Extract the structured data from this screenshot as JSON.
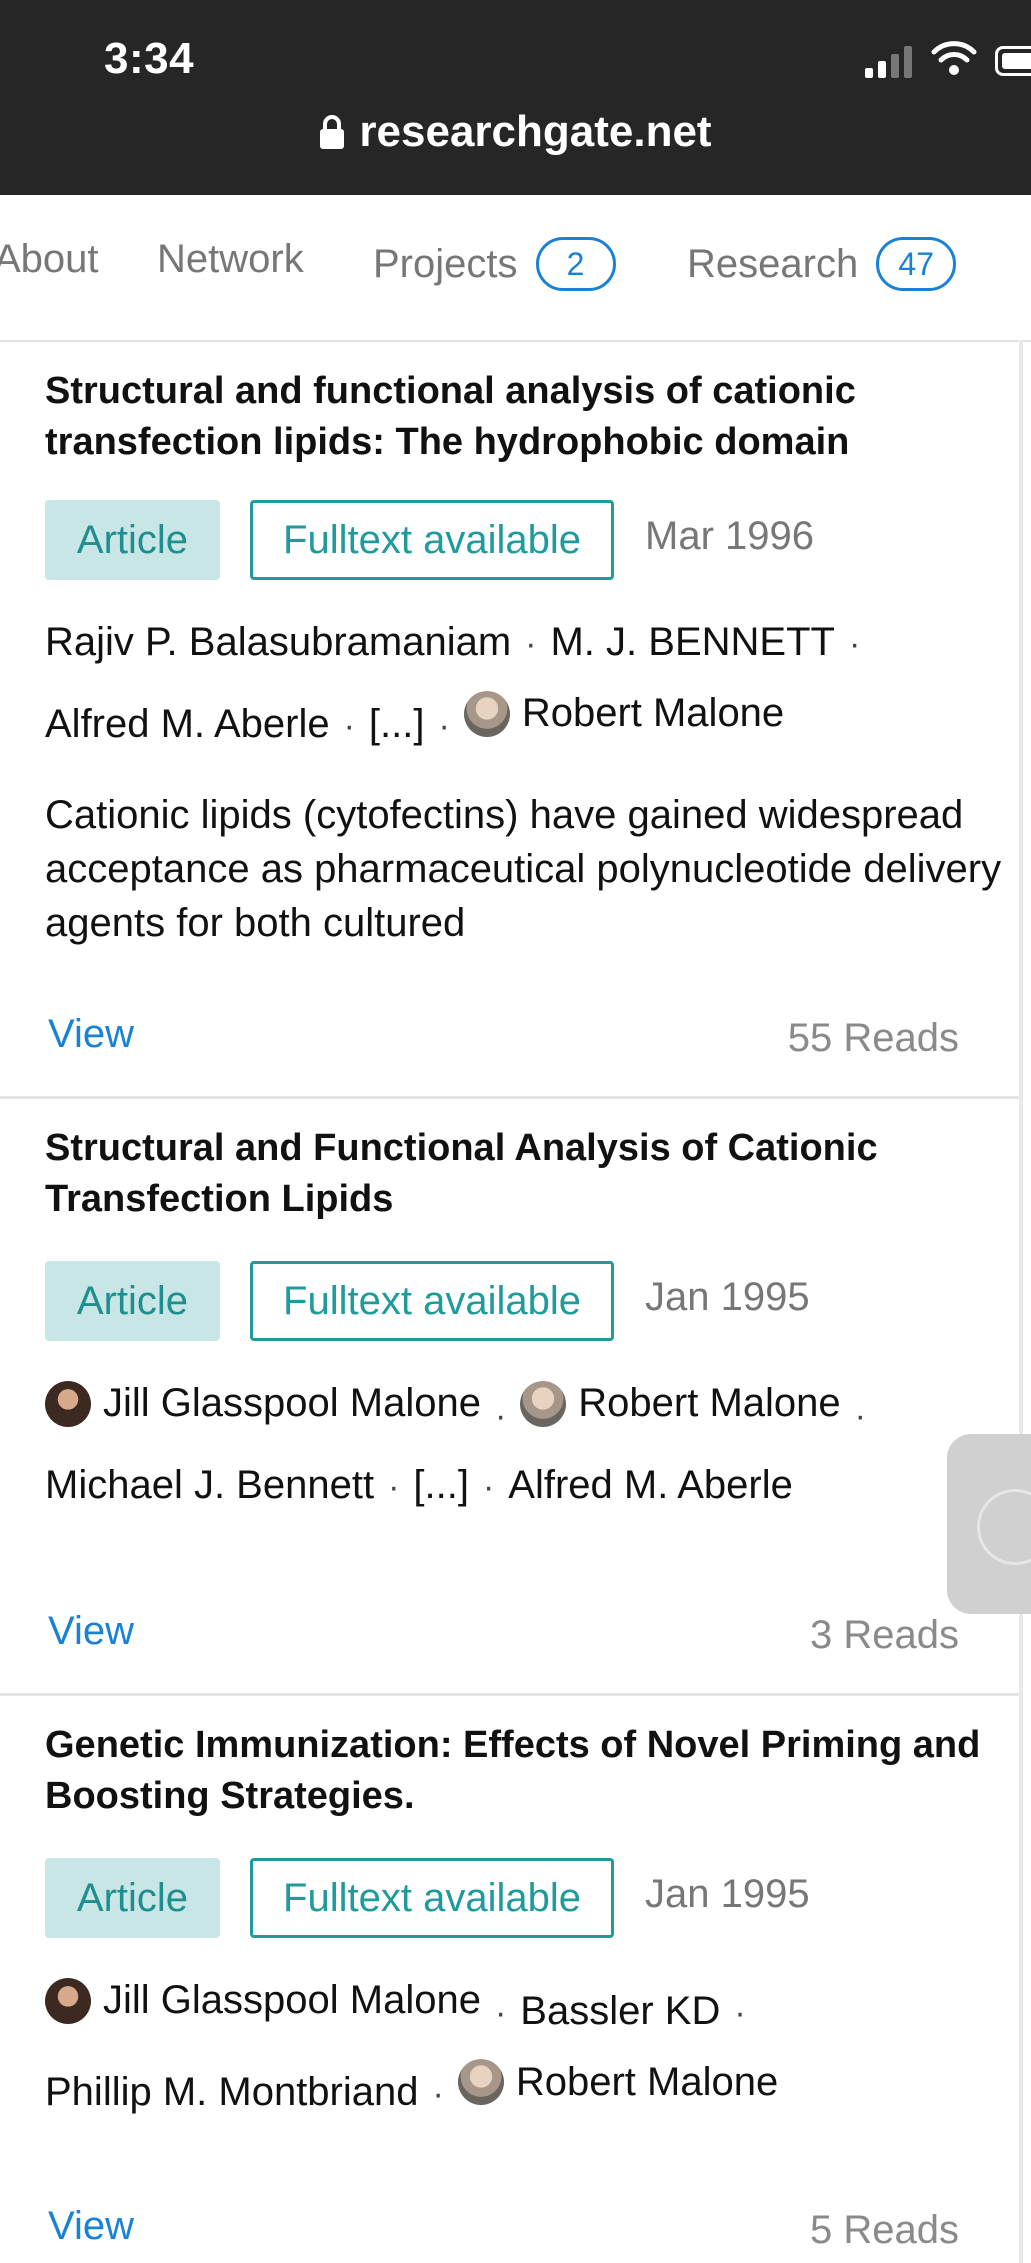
{
  "status_bar": {
    "time": "3:34",
    "url": "researchgate.net"
  },
  "tabs": [
    {
      "label": "About"
    },
    {
      "label": "Network"
    },
    {
      "label": "Projects",
      "count": "2"
    },
    {
      "label": "Research",
      "count": "47"
    }
  ],
  "publications": [
    {
      "title": "Structural and functional analysis of cationic transfection lipids: The hydrophobic domain",
      "type": "Article",
      "availability": "Fulltext available",
      "date": "Mar 1996",
      "authors": [
        "Rajiv P. Balasubramaniam",
        "M. J. BENNETT",
        "Alfred M. Aberle",
        "[...]",
        "Robert Malone"
      ],
      "abstract": "Cationic lipids (cytofectins) have gained widespread acceptance as pharmaceutical polynucleotide delivery agents for both cultured",
      "view_label": "View",
      "reads": "55 Reads"
    },
    {
      "title": "Structural and Functional Analysis of Cationic Transfection Lipids",
      "type": "Article",
      "availability": "Fulltext available",
      "date": "Jan 1995",
      "authors": [
        "Jill Glasspool Malone",
        "Robert Malone",
        "Michael J. Bennett",
        "[...]",
        "Alfred M. Aberle"
      ],
      "view_label": "View",
      "reads": "3 Reads"
    },
    {
      "title": "Genetic Immunization: Effects of Novel Priming and Boosting Strategies.",
      "type": "Article",
      "availability": "Fulltext available",
      "date": "Jan 1995",
      "authors": [
        "Jill Glasspool Malone",
        "Bassler KD",
        "Phillip M. Montbriand",
        "Robert Malone"
      ],
      "view_label": "View",
      "reads": "5 Reads"
    }
  ],
  "icons": {
    "status": [
      "cellular-signal-icon",
      "wifi-icon",
      "battery-icon",
      "lock-icon"
    ],
    "avatars": [
      "robert-malone-avatar",
      "jill-glasspool-malone-avatar"
    ]
  },
  "colors": {
    "accent_blue": "#1a82d6",
    "teal": "#1f9b9b",
    "article_bg": "#c9e6e6",
    "statusbar_bg": "#262626"
  }
}
